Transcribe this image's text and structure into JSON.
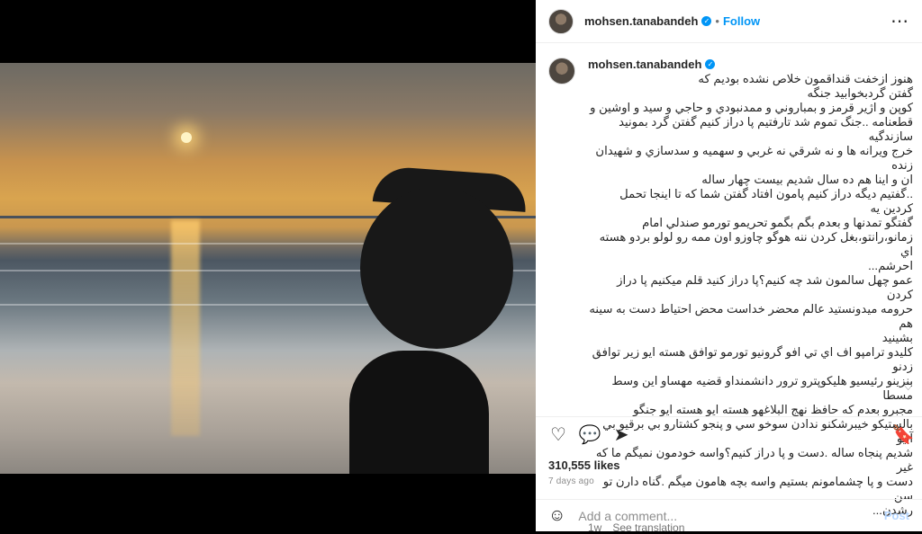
{
  "post": {
    "username": "mohsen.tanabandeh",
    "follow_label": "Follow",
    "separator": "•",
    "caption": "هنوز ازخفت قنداقمون خلاص نشده بوديم كه\nگفتن گردبخوابيد جنگه\nكوپن و اژير قرمز و بمباروني و ممدنبودي و حاجي و سيد و اوشين و\nقطعنامه ..جنگ تموم شد تارفتيم پا دراز كنيم گفتن گرد بمونيد سازندگيه\nخرج ويرانه ها و نه شرقي نه غربي و سهميه و سدسازي و شهيدان زنده\nان و اينا هم ده سال شديم بيست چهار ساله\n..گفتيم ديگه دراز كنيم پامون افتاد گفتن شما كه تا اينجا تحمل كردين يه\nگفتگو تمدنها و بعدم بگم بگمو تحريمو تورمو صندلي امام\nزمانو،رانتو،بغل كردن ننه هوگو چاوزو اون ممه رو لولو بردو هسته اي\nاحرشم...\nعمو چهل سالمون شد چه كنيم؟پا دراز كنيد قلم ميكنيم پا دراز كردن\nحرومه ميدونستيد عالم محضر خداست محض احتياط دست به سينه هم\nبشينيد\nكليدو ترامپو اف اي تي افو گرونيو تورمو توافق هسته ايو زير توافق زدنو\nبنزينو رئيسيو هليكوپترو ترور دانشمنداو قضيه مهساو اين وسط مسطا\nمجبرو بعدم كه حافظ نهج البلاغهو هسته ايو هسته ايو جنگو\nبالستيكو خيبرشكنو ندادن سوخو سي و پنجو كشتارو بي برقيو بي آبيو\nشديم پنجاه ساله .دست و پا دراز كنيم؟واسه خودمون نميگم ما كه غير\nدست و پا چشمامونم بستيم واسه بچه هامون ميگم .گناه دارن تو سن\nرشدن...",
    "caption_age": "1w",
    "see_translation": "See translation",
    "likes": "310,555 likes",
    "posted_ago": "7 days ago",
    "comment_placeholder": "Add a comment...",
    "post_label": "Post"
  },
  "icons": {
    "verified": "verified-badge-icon",
    "more": "more-options-icon",
    "heart": "heart-icon",
    "comment": "comment-icon",
    "share": "share-icon",
    "save": "save-icon",
    "emoji": "emoji-icon",
    "comment_like": "heart-icon"
  },
  "colors": {
    "accent": "#0095f6",
    "text": "#262626",
    "muted": "#737373"
  }
}
